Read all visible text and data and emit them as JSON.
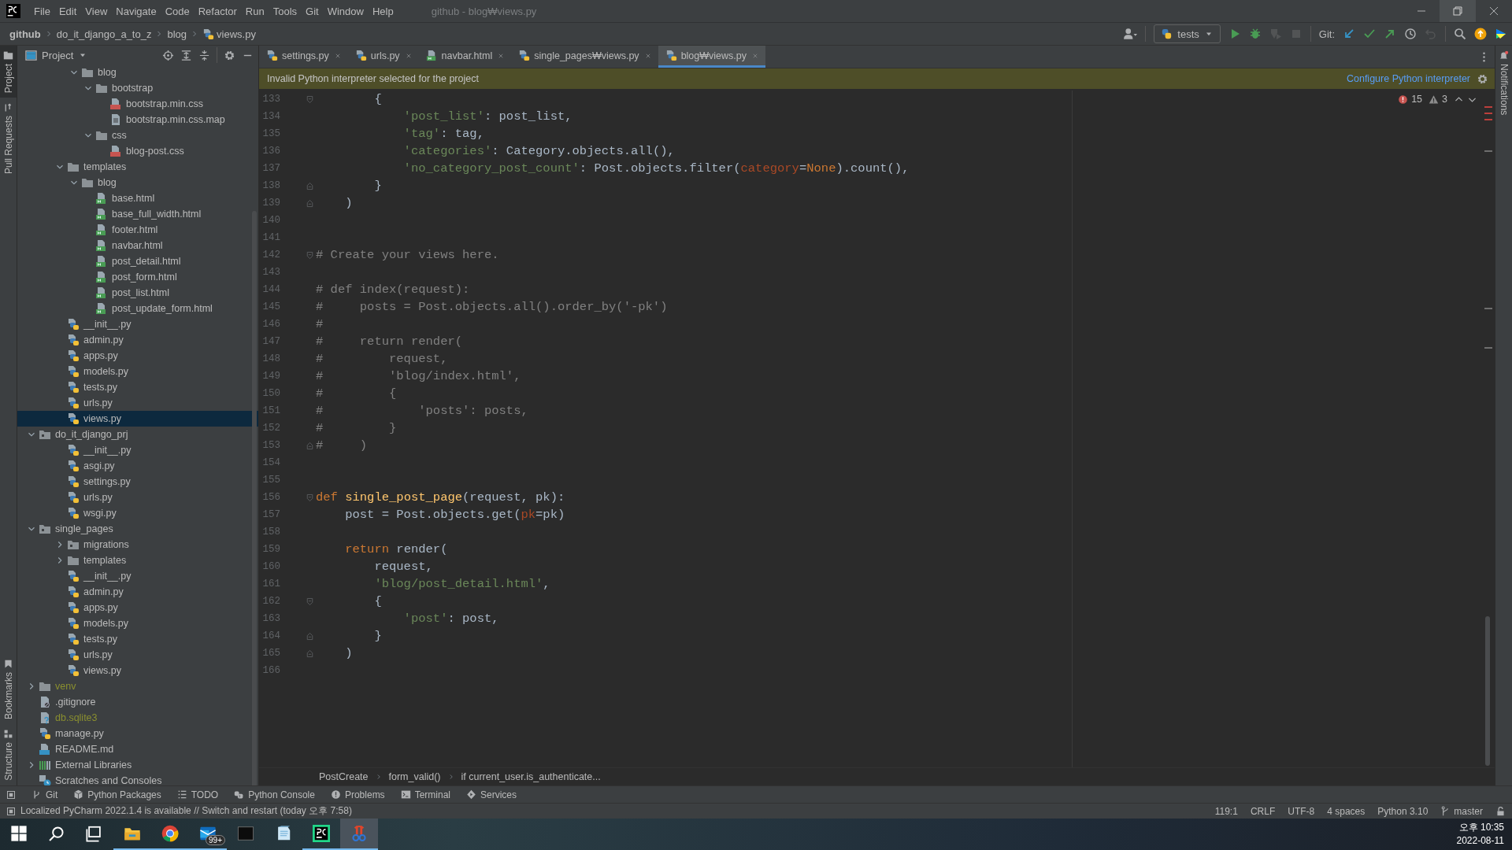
{
  "menu_bar": {
    "menus": [
      "File",
      "Edit",
      "View",
      "Navigate",
      "Code",
      "Refactor",
      "Run",
      "Tools",
      "Git",
      "Window",
      "Help"
    ],
    "title": "github - blog₩views.py"
  },
  "nav_bar": {
    "breadcrumbs": [
      {
        "label": "github",
        "kind": "root"
      },
      {
        "label": "do_it_django_a_to_z",
        "kind": "folder"
      },
      {
        "label": "blog",
        "kind": "folder"
      },
      {
        "label": "views.py",
        "kind": "py"
      }
    ],
    "run_config": "tests",
    "git_label": "Git:",
    "run_tools": [
      {
        "kind": "run",
        "disabled": false
      },
      {
        "kind": "debug",
        "disabled": false
      },
      {
        "kind": "coverage",
        "disabled": true
      },
      {
        "kind": "stop",
        "disabled": true
      }
    ],
    "git_tools": [
      {
        "kind": "update",
        "disabled": false
      },
      {
        "kind": "commit",
        "disabled": false
      },
      {
        "kind": "push",
        "disabled": false
      },
      {
        "kind": "history",
        "disabled": false
      },
      {
        "kind": "rollback",
        "disabled": true
      }
    ],
    "end_tools": [
      {
        "kind": "search",
        "disabled": false
      },
      {
        "kind": "ide-update",
        "disabled": false
      },
      {
        "kind": "toolbox",
        "disabled": false
      }
    ]
  },
  "left_strip": {
    "top": [
      {
        "label": "Project",
        "kind": "project",
        "selected": true
      },
      {
        "label": "Pull Requests",
        "kind": "pr",
        "selected": false
      }
    ],
    "bottom": [
      {
        "label": "Bookmarks",
        "kind": "bookmark",
        "selected": false
      },
      {
        "label": "Structure",
        "kind": "structure",
        "selected": false
      }
    ]
  },
  "right_strip": [
    {
      "label": "Notifications",
      "kind": "bell",
      "selected": false
    }
  ],
  "project": {
    "title": "Project",
    "tree": [
      {
        "children": [
          {
            "children": [
              {
                "children": [
                  {
                    "label": "blog",
                    "kind": "folder",
                    "expanded": true,
                    "selected": false,
                    "ignored": false,
                    "children": [
                      {
                        "label": "bootstrap",
                        "kind": "folder",
                        "expanded": true,
                        "selected": false,
                        "ignored": false,
                        "children": [
                          {
                            "label": "bootstrap.min.css",
                            "kind": "css",
                            "selected": false,
                            "ignored": false
                          },
                          {
                            "label": "bootstrap.min.css.map",
                            "kind": "text",
                            "selected": false,
                            "ignored": false
                          }
                        ]
                      },
                      {
                        "label": "css",
                        "kind": "folder",
                        "expanded": true,
                        "selected": false,
                        "ignored": false,
                        "children": [
                          {
                            "label": "blog-post.css",
                            "kind": "css",
                            "selected": false,
                            "ignored": false
                          }
                        ]
                      }
                    ]
                  }
                ]
              },
              {
                "label": "templates",
                "kind": "folder",
                "expanded": true,
                "selected": false,
                "ignored": false,
                "children": [
                  {
                    "label": "blog",
                    "kind": "folder",
                    "expanded": true,
                    "selected": false,
                    "ignored": false,
                    "children": [
                      {
                        "label": "base.html",
                        "kind": "html",
                        "selected": false,
                        "ignored": false
                      },
                      {
                        "label": "base_full_width.html",
                        "kind": "html",
                        "selected": false,
                        "ignored": false
                      },
                      {
                        "label": "footer.html",
                        "kind": "html",
                        "selected": false,
                        "ignored": false
                      },
                      {
                        "label": "navbar.html",
                        "kind": "html",
                        "selected": false,
                        "ignored": false
                      },
                      {
                        "label": "post_detail.html",
                        "kind": "html",
                        "selected": false,
                        "ignored": false
                      },
                      {
                        "label": "post_form.html",
                        "kind": "html",
                        "selected": false,
                        "ignored": false
                      },
                      {
                        "label": "post_list.html",
                        "kind": "html",
                        "selected": false,
                        "ignored": false
                      },
                      {
                        "label": "post_update_form.html",
                        "kind": "html",
                        "selected": false,
                        "ignored": false
                      }
                    ]
                  }
                ]
              },
              {
                "label": "__init__.py",
                "kind": "py",
                "selected": false,
                "ignored": false
              },
              {
                "label": "admin.py",
                "kind": "py",
                "selected": false,
                "ignored": false
              },
              {
                "label": "apps.py",
                "kind": "py",
                "selected": false,
                "ignored": false
              },
              {
                "label": "models.py",
                "kind": "py",
                "selected": false,
                "ignored": false
              },
              {
                "label": "tests.py",
                "kind": "py",
                "selected": false,
                "ignored": false
              },
              {
                "label": "urls.py",
                "kind": "py",
                "selected": false,
                "ignored": false
              },
              {
                "label": "views.py",
                "kind": "py",
                "selected": true,
                "ignored": false
              }
            ]
          },
          {
            "label": "do_it_django_prj",
            "kind": "pkg",
            "expanded": true,
            "selected": false,
            "ignored": false,
            "children": [
              {
                "label": "__init__.py",
                "kind": "py",
                "selected": false,
                "ignored": false
              },
              {
                "label": "asgi.py",
                "kind": "py",
                "selected": false,
                "ignored": false
              },
              {
                "label": "settings.py",
                "kind": "py",
                "selected": false,
                "ignored": false
              },
              {
                "label": "urls.py",
                "kind": "py",
                "selected": false,
                "ignored": false
              },
              {
                "label": "wsgi.py",
                "kind": "py",
                "selected": false,
                "ignored": false
              }
            ]
          },
          {
            "label": "single_pages",
            "kind": "pkg",
            "expanded": true,
            "selected": false,
            "ignored": false,
            "children": [
              {
                "label": "migrations",
                "kind": "pkg",
                "expanded": false,
                "selected": false,
                "ignored": false
              },
              {
                "label": "templates",
                "kind": "folder",
                "expanded": false,
                "selected": false,
                "ignored": false
              },
              {
                "label": "__init__.py",
                "kind": "py",
                "selected": false,
                "ignored": false
              },
              {
                "label": "admin.py",
                "kind": "py",
                "selected": false,
                "ignored": false
              },
              {
                "label": "apps.py",
                "kind": "py",
                "selected": false,
                "ignored": false
              },
              {
                "label": "models.py",
                "kind": "py",
                "selected": false,
                "ignored": false
              },
              {
                "label": "tests.py",
                "kind": "py",
                "selected": false,
                "ignored": false
              },
              {
                "label": "urls.py",
                "kind": "py",
                "selected": false,
                "ignored": false
              },
              {
                "label": "views.py",
                "kind": "py",
                "selected": false,
                "ignored": false
              }
            ]
          },
          {
            "label": "venv",
            "kind": "folder",
            "expanded": false,
            "selected": false,
            "ignored": true
          },
          {
            "label": ".gitignore",
            "kind": "gitignore",
            "selected": false,
            "ignored": false
          },
          {
            "label": "db.sqlite3",
            "kind": "unknown",
            "selected": false,
            "ignored": true
          },
          {
            "label": "manage.py",
            "kind": "py",
            "selected": false,
            "ignored": false
          },
          {
            "label": "README.md",
            "kind": "md",
            "selected": false,
            "ignored": false
          }
        ]
      },
      {
        "label": "External Libraries",
        "kind": "libs",
        "expanded": false,
        "selected": false,
        "ignored": false
      },
      {
        "label": "Scratches and Consoles",
        "kind": "scratch",
        "selected": false,
        "ignored": false
      }
    ]
  },
  "editor": {
    "tabs": [
      {
        "label": "settings.py",
        "kind": "py",
        "selected": false
      },
      {
        "label": "urls.py",
        "kind": "py",
        "selected": false
      },
      {
        "label": "navbar.html",
        "kind": "html",
        "selected": false
      },
      {
        "label": "single_pages₩views.py",
        "kind": "py",
        "selected": false
      },
      {
        "label": "blog₩views.py",
        "kind": "py",
        "selected": true
      }
    ],
    "banner": {
      "message": "Invalid Python interpreter selected for the project",
      "link": "Configure Python interpreter"
    },
    "inspections": {
      "errors": "15",
      "warnings": "3"
    },
    "lines": [
      {
        "n": "133",
        "kind": "fold-start",
        "toks": [
          {
            "kind": "plain",
            "text": "        {"
          }
        ]
      },
      {
        "n": "134",
        "kind": "plain",
        "toks": [
          {
            "kind": "string",
            "text": "            'post_list'"
          },
          {
            "kind": "plain",
            "text": ": post_list,"
          }
        ]
      },
      {
        "n": "135",
        "kind": "plain",
        "toks": [
          {
            "kind": "string",
            "text": "            'tag'"
          },
          {
            "kind": "plain",
            "text": ": tag,"
          }
        ]
      },
      {
        "n": "136",
        "kind": "plain",
        "toks": [
          {
            "kind": "string",
            "text": "            'categories'"
          },
          {
            "kind": "plain",
            "text": ": Category.objects.all(),"
          }
        ]
      },
      {
        "n": "137",
        "kind": "plain",
        "toks": [
          {
            "kind": "string",
            "text": "            'no_category_post_count'"
          },
          {
            "kind": "plain",
            "text": ": Post.objects.filter("
          },
          {
            "kind": "kwarg",
            "text": "category"
          },
          {
            "kind": "plain",
            "text": "="
          },
          {
            "kind": "keyword",
            "text": "None"
          },
          {
            "kind": "plain",
            "text": ").count(),"
          }
        ]
      },
      {
        "n": "138",
        "kind": "fold-end",
        "toks": [
          {
            "kind": "plain",
            "text": "        }"
          }
        ]
      },
      {
        "n": "139",
        "kind": "fold-end",
        "toks": [
          {
            "kind": "plain",
            "text": "    )"
          }
        ]
      },
      {
        "n": "140",
        "kind": "plain"
      },
      {
        "n": "141",
        "kind": "plain"
      },
      {
        "n": "142",
        "kind": "fold-start",
        "toks": [
          {
            "kind": "comment",
            "text": "# Create your views here."
          }
        ]
      },
      {
        "n": "143",
        "kind": "plain"
      },
      {
        "n": "144",
        "kind": "plain",
        "toks": [
          {
            "kind": "comment",
            "text": "# def index(request):"
          }
        ]
      },
      {
        "n": "145",
        "kind": "plain",
        "toks": [
          {
            "kind": "comment",
            "text": "#     posts = Post.objects.all().order_by('-pk')"
          }
        ]
      },
      {
        "n": "146",
        "kind": "plain",
        "toks": [
          {
            "kind": "comment",
            "text": "#"
          }
        ]
      },
      {
        "n": "147",
        "kind": "plain",
        "toks": [
          {
            "kind": "comment",
            "text": "#     return render("
          }
        ]
      },
      {
        "n": "148",
        "kind": "plain",
        "toks": [
          {
            "kind": "comment",
            "text": "#         request,"
          }
        ]
      },
      {
        "n": "149",
        "kind": "plain",
        "toks": [
          {
            "kind": "comment",
            "text": "#         'blog/index.html',"
          }
        ]
      },
      {
        "n": "150",
        "kind": "plain",
        "toks": [
          {
            "kind": "comment",
            "text": "#         {"
          }
        ]
      },
      {
        "n": "151",
        "kind": "plain",
        "toks": [
          {
            "kind": "comment",
            "text": "#             'posts': posts,"
          }
        ]
      },
      {
        "n": "152",
        "kind": "plain",
        "toks": [
          {
            "kind": "comment",
            "text": "#         }"
          }
        ]
      },
      {
        "n": "153",
        "kind": "fold-end",
        "toks": [
          {
            "kind": "comment",
            "text": "#     )"
          }
        ]
      },
      {
        "n": "154",
        "kind": "plain"
      },
      {
        "n": "155",
        "kind": "plain"
      },
      {
        "n": "156",
        "kind": "fold-start",
        "toks": [
          {
            "kind": "keyword",
            "text": "def "
          },
          {
            "kind": "function",
            "text": "single_post_page"
          },
          {
            "kind": "plain",
            "text": "(request, pk):"
          }
        ]
      },
      {
        "n": "157",
        "kind": "plain",
        "toks": [
          {
            "kind": "plain",
            "text": "    post = Post.objects.get("
          },
          {
            "kind": "kwarg",
            "text": "pk"
          },
          {
            "kind": "plain",
            "text": "=pk)"
          }
        ]
      },
      {
        "n": "158",
        "kind": "plain"
      },
      {
        "n": "159",
        "kind": "plain",
        "toks": [
          {
            "kind": "keyword",
            "text": "    return "
          },
          {
            "kind": "plain",
            "text": "render("
          }
        ]
      },
      {
        "n": "160",
        "kind": "plain",
        "toks": [
          {
            "kind": "plain",
            "text": "        request,"
          }
        ]
      },
      {
        "n": "161",
        "kind": "plain",
        "toks": [
          {
            "kind": "string",
            "text": "        'blog/post_detail.html'"
          },
          {
            "kind": "plain",
            "text": ","
          }
        ]
      },
      {
        "n": "162",
        "kind": "fold-start",
        "toks": [
          {
            "kind": "plain",
            "text": "        {"
          }
        ]
      },
      {
        "n": "163",
        "kind": "plain",
        "toks": [
          {
            "kind": "string",
            "text": "            'post'"
          },
          {
            "kind": "plain",
            "text": ": post,"
          }
        ]
      },
      {
        "n": "164",
        "kind": "fold-end",
        "toks": [
          {
            "kind": "plain",
            "text": "        }"
          }
        ]
      },
      {
        "n": "165",
        "kind": "fold-end",
        "toks": [
          {
            "kind": "plain",
            "text": "    )"
          }
        ]
      },
      {
        "n": "166",
        "kind": "plain"
      }
    ],
    "breadcrumbs": [
      "PostCreate",
      "form_valid()",
      "if current_user.is_authenticate..."
    ]
  },
  "tool_windows": [
    {
      "label": "Git",
      "kind": "git"
    },
    {
      "label": "Python Packages",
      "kind": "packages"
    },
    {
      "label": "TODO",
      "kind": "todo"
    },
    {
      "label": "Python Console",
      "kind": "console"
    },
    {
      "label": "Problems",
      "kind": "problems"
    },
    {
      "label": "Terminal",
      "kind": "terminal"
    },
    {
      "label": "Services",
      "kind": "services"
    }
  ],
  "status_bar": {
    "message": "Localized PyCharm 2022.1.4 is available // Switch and restart (today 오후 7:58)",
    "widgets": [
      {
        "label": "119:1",
        "kind": "text"
      },
      {
        "label": "CRLF",
        "kind": "text"
      },
      {
        "label": "UTF-8",
        "kind": "text"
      },
      {
        "label": "4 spaces",
        "kind": "text"
      },
      {
        "label": "Python 3.10",
        "kind": "text"
      },
      {
        "label": "master",
        "kind": "branch"
      },
      {
        "kind": "lock"
      }
    ]
  },
  "taskbar": {
    "apps": [
      {
        "kind": "start",
        "running": false,
        "selected": false
      },
      {
        "kind": "search",
        "running": false,
        "selected": false
      },
      {
        "kind": "taskview",
        "running": false,
        "selected": false
      },
      {
        "kind": "explorer",
        "running": true,
        "selected": false
      },
      {
        "kind": "chrome",
        "running": true,
        "selected": false
      },
      {
        "kind": "mail",
        "running": true,
        "selected": false,
        "badge": "99+"
      },
      {
        "kind": "terminal",
        "running": false,
        "selected": false
      },
      {
        "kind": "notepad",
        "running": false,
        "selected": false
      },
      {
        "kind": "pycharm",
        "running": true,
        "selected": false
      },
      {
        "kind": "snip",
        "running": true,
        "selected": true
      }
    ],
    "time": "오후 10:35",
    "date": "2022-08-11"
  }
}
